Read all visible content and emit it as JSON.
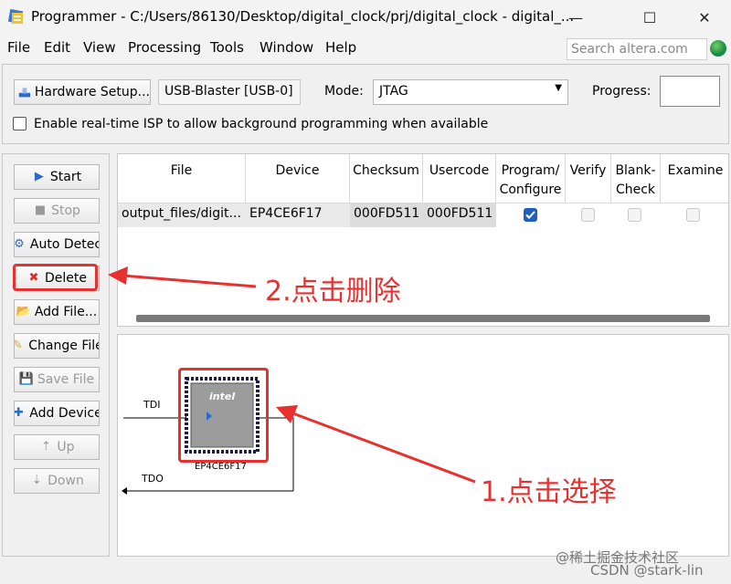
{
  "window": {
    "title": "Programmer - C:/Users/86130/Desktop/digital_clock/prj/digital_clock - digital_...",
    "minimize": "—",
    "maximize": "☐",
    "close": "✕"
  },
  "menu": {
    "items": [
      "File",
      "Edit",
      "View",
      "Processing",
      "Tools",
      "Window",
      "Help"
    ],
    "search_placeholder": "Search altera.com"
  },
  "hardware": {
    "setup_button": "Hardware Setup...",
    "hardware_value": "USB-Blaster [USB-0]",
    "mode_label": "Mode:",
    "mode_value": "JTAG",
    "progress_label": "Progress:",
    "isp_label": "Enable real-time ISP to allow background programming when available"
  },
  "side_buttons": {
    "start": "Start",
    "stop": "Stop",
    "auto_detect": "Auto Detec",
    "delete": "Delete",
    "add_file": "Add File...",
    "change_file": "Change File",
    "save_file": "Save File",
    "add_device": "Add Device",
    "up": "Up",
    "down": "Down"
  },
  "table": {
    "headers": {
      "file": "File",
      "device": "Device",
      "checksum": "Checksum",
      "usercode": "Usercode",
      "program_1": "Program/",
      "program_2": "Configure",
      "verify": "Verify",
      "blank_1": "Blank-",
      "blank_2": "Check",
      "examine": "Examine"
    },
    "row": {
      "file": "output_files/digit...",
      "device": "EP4CE6F17",
      "checksum": "000FD511",
      "usercode": "000FD511",
      "program": true,
      "verify": false,
      "blank": false,
      "examine": false
    }
  },
  "chain": {
    "tdi": "TDI",
    "tdo": "TDO",
    "chip_logo": "intel",
    "chip_label": "EP4CE6F17"
  },
  "annotations": {
    "delete_note": "2.点击删除",
    "select_note": "1.点击选择"
  },
  "watermark": {
    "line1": "@稀土掘金技术社区",
    "line2": "CSDN @stark-lin"
  },
  "colors": {
    "annotation_red": "#e8312f",
    "checkbox_blue": "#1f5fbf",
    "chip_gray": "#9c9c9c"
  }
}
